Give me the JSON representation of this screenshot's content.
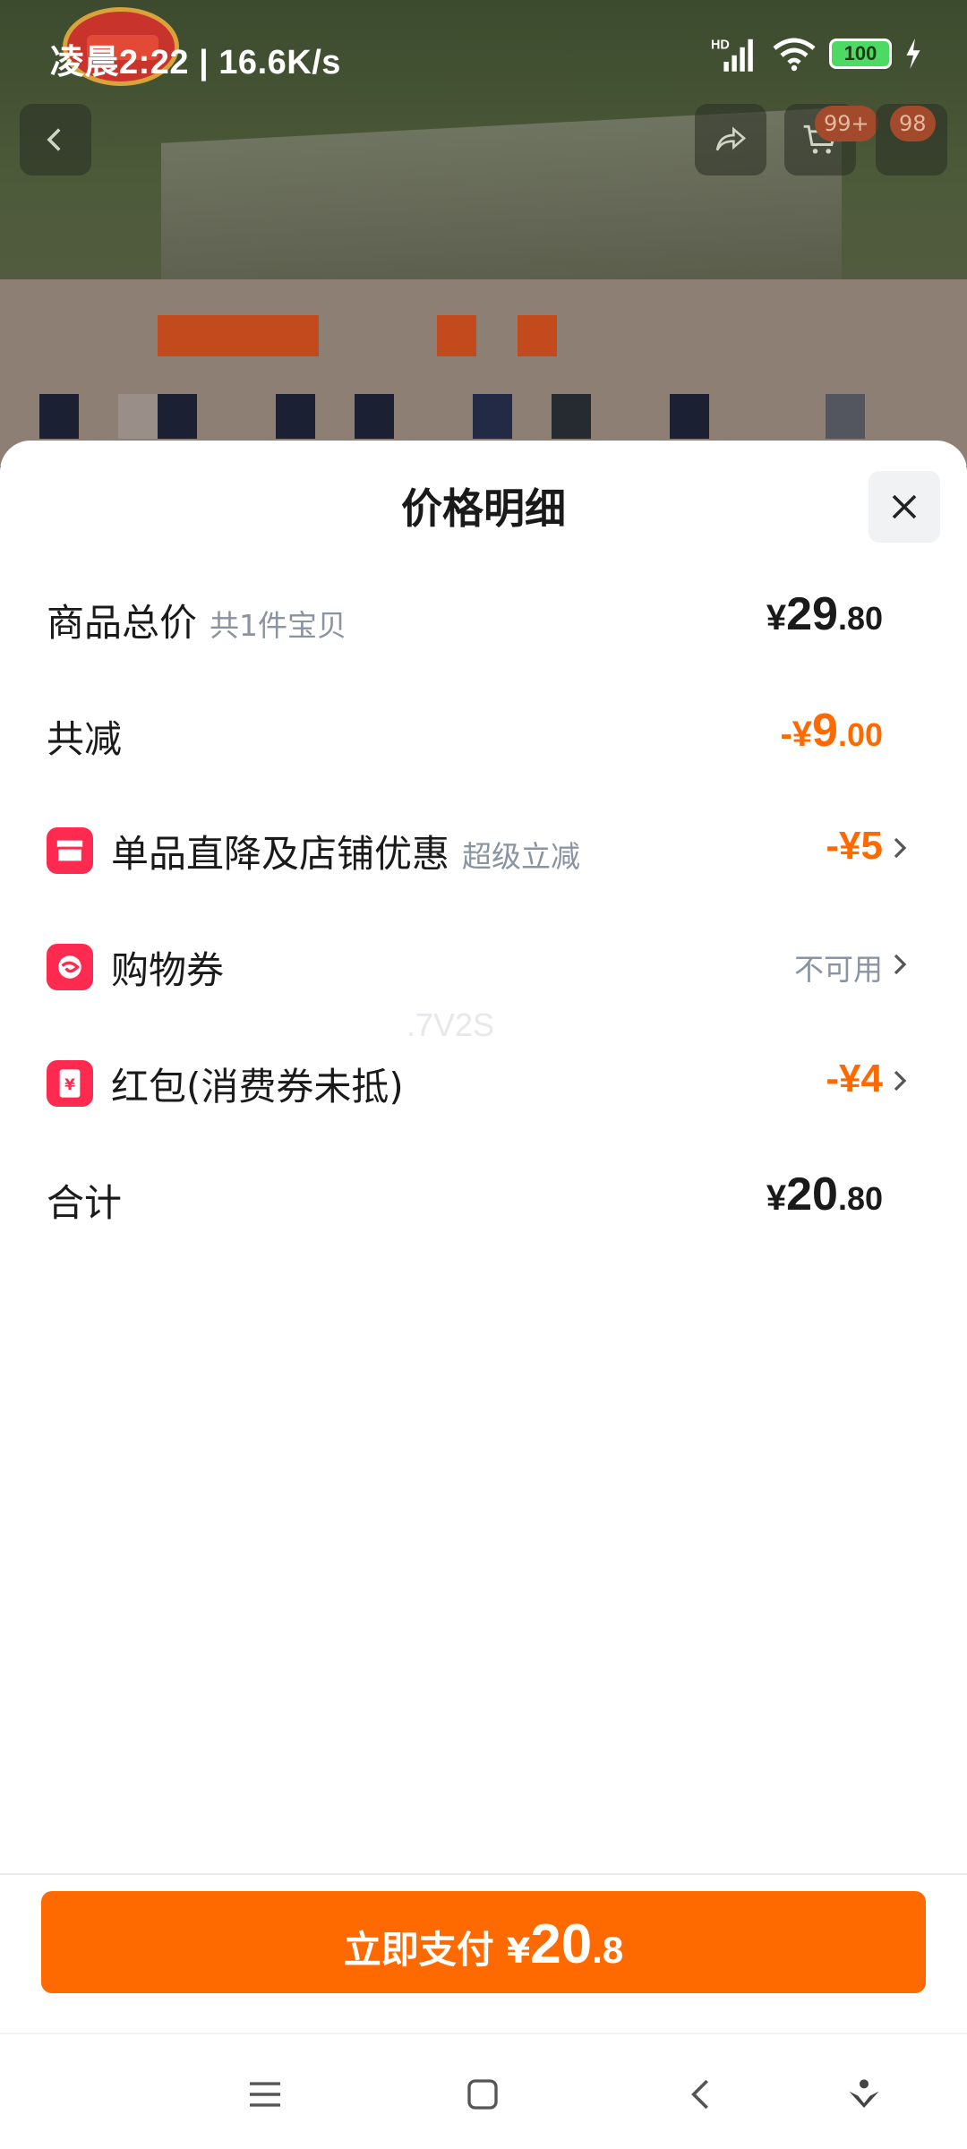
{
  "status_bar": {
    "time_speed": "凌晨2:22 | 16.6K/s",
    "battery": "100",
    "network": "HD"
  },
  "background": {
    "cart_badge": "99+",
    "count_badge": "98"
  },
  "sheet": {
    "title": "价格明细",
    "rows": [
      {
        "label": "商品总价",
        "sub": "共1件宝贝",
        "yen": "¥",
        "int": "29",
        "dec": ".80"
      },
      {
        "label": "共减",
        "prefix": "-¥",
        "int": "9",
        "dec": ".00"
      },
      {
        "label": "单品直降及店铺优惠",
        "sub": "超级立减",
        "value": "-¥5",
        "icon": "store-icon"
      },
      {
        "label": "购物券",
        "value": "不可用",
        "icon": "coupon-icon"
      },
      {
        "label": "红包(消费券未抵)",
        "value": "-¥4",
        "icon": "red-packet-icon"
      },
      {
        "label": "合计",
        "yen": "¥",
        "int": "20",
        "dec": ".80"
      }
    ],
    "watermark": ".7V2S"
  },
  "pay_button": {
    "label": "立即支付",
    "yen": "¥",
    "int": "20",
    "dec": ".8"
  },
  "colors": {
    "accent": "#ff6a00",
    "icon_red": "#ff2a4f",
    "muted": "#8a93a1"
  },
  "nav": [
    "menu-icon",
    "home-icon",
    "back-icon",
    "assistant-icon"
  ]
}
